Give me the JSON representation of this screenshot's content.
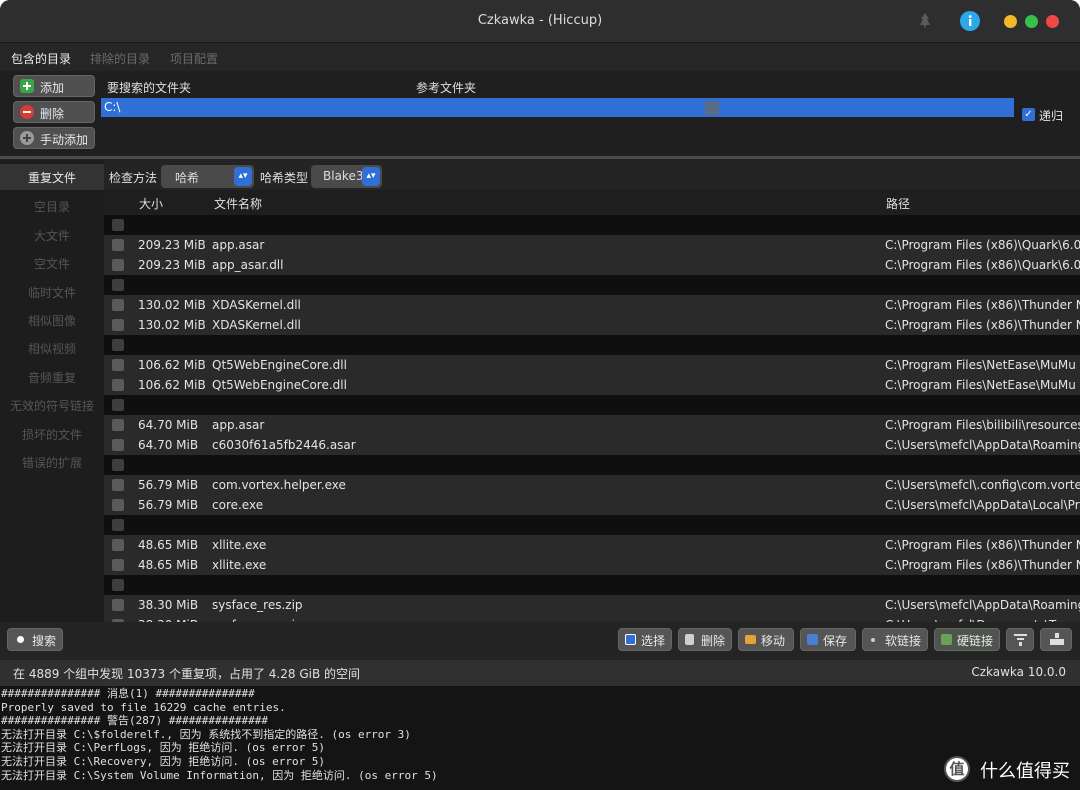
{
  "window": {
    "title": "Czkawka - (Hiccup)",
    "controls": {
      "close": "#f2b92a",
      "minimize": "#f2b92a",
      "maximize": "#35c24a",
      "exit": "#f04848"
    }
  },
  "tabs": [
    "包含的目录",
    "排除的目录",
    "项目配置"
  ],
  "dir_panel": {
    "add_label": "添加",
    "remove_label": "删除",
    "manual_add_label": "手动添加",
    "col_search": "要搜索的文件夹",
    "col_reference": "参考文件夹",
    "dir_value": "C:\\",
    "recursive_label": "递归"
  },
  "nav": [
    "重复文件",
    "空目录",
    "大文件",
    "空文件",
    "临时文件",
    "相似图像",
    "相似视频",
    "音频重复",
    "无效的符号链接",
    "损坏的文件",
    "错误的扩展"
  ],
  "method": {
    "check_label": "检查方法",
    "check_value": "哈希",
    "hash_label": "哈希类型",
    "hash_value": "Blake3"
  },
  "table": {
    "col_size": "大小",
    "col_name": "文件名称",
    "col_path": "路径",
    "groups": [
      [
        {
          "size": "209.23 MiB",
          "name": "app.asar",
          "path": "C:\\Program Files (x86)\\Quark\\6.0"
        },
        {
          "size": "209.23 MiB",
          "name": "app_asar.dll",
          "path": "C:\\Program Files (x86)\\Quark\\6.0"
        }
      ],
      [
        {
          "size": "130.02 MiB",
          "name": "XDASKernel.dll",
          "path": "C:\\Program Files (x86)\\Thunder N"
        },
        {
          "size": "130.02 MiB",
          "name": "XDASKernel.dll",
          "path": "C:\\Program Files (x86)\\Thunder N"
        }
      ],
      [
        {
          "size": "106.62 MiB",
          "name": "Qt5WebEngineCore.dll",
          "path": "C:\\Program Files\\NetEase\\MuMu"
        },
        {
          "size": "106.62 MiB",
          "name": "Qt5WebEngineCore.dll",
          "path": "C:\\Program Files\\NetEase\\MuMu"
        }
      ],
      [
        {
          "size": "64.70 MiB",
          "name": "app.asar",
          "path": "C:\\Program Files\\bilibili\\resources"
        },
        {
          "size": "64.70 MiB",
          "name": "c6030f61a5fb2446.asar",
          "path": "C:\\Users\\mefcl\\AppData\\Roaming"
        }
      ],
      [
        {
          "size": "56.79 MiB",
          "name": "com.vortex.helper.exe",
          "path": "C:\\Users\\mefcl\\.config\\com.vorte"
        },
        {
          "size": "56.79 MiB",
          "name": "core.exe",
          "path": "C:\\Users\\mefcl\\AppData\\Local\\Pr"
        }
      ],
      [
        {
          "size": "48.65 MiB",
          "name": "xllite.exe",
          "path": "C:\\Program Files (x86)\\Thunder N"
        },
        {
          "size": "48.65 MiB",
          "name": "xllite.exe",
          "path": "C:\\Program Files (x86)\\Thunder N"
        }
      ],
      [
        {
          "size": "38.30 MiB",
          "name": "sysface_res.zip",
          "path": "C:\\Users\\mefcl\\AppData\\Roaming"
        },
        {
          "size": "38.30 MiB",
          "name": "sysface_res.zip",
          "path": "C:\\Users\\mefcl\\Documents\\Tence"
        }
      ]
    ]
  },
  "buttons": {
    "search": "搜索",
    "select": "选择",
    "delete": "删除",
    "move": "移动",
    "save": "保存",
    "symlink": "软链接",
    "hardlink": "硬链接"
  },
  "status": {
    "summary": "在 4889 个组中发现 10373 个重复项，占用了 4.28 GiB 的空间",
    "version": "Czkawka 10.0.0"
  },
  "log": [
    "############### 消息(1) ###############",
    "Properly saved to file 16229 cache entries.",
    "############### 警告(287) ###############",
    "无法打开目录 C:\\$folderelf., 因为 系统找不到指定的路径. (os error 3)",
    "无法打开目录 C:\\PerfLogs, 因为 拒绝访问. (os error 5)",
    "无法打开目录 C:\\Recovery, 因为 拒绝访问. (os error 5)",
    "无法打开目录 C:\\System Volume Information, 因为 拒绝访问. (os error 5)"
  ],
  "watermark": {
    "text": "什么值得买",
    "mark": "值"
  }
}
